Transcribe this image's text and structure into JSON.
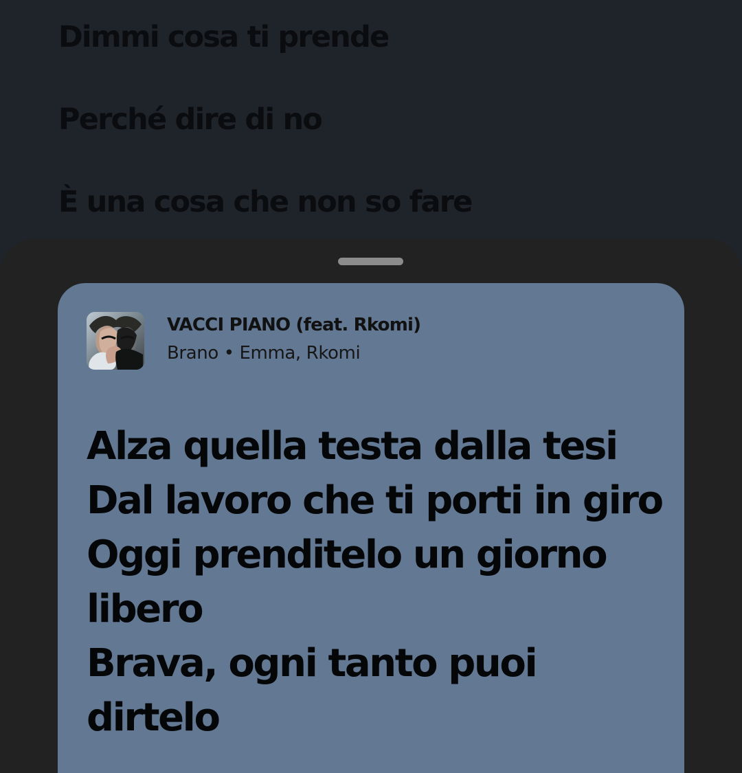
{
  "background_lyrics": [
    "Dimmi cosa ti prende",
    "Perché dire di no",
    "È una cosa che non so fare"
  ],
  "share_sheet": {
    "handle_icon": "drag-handle-icon",
    "card": {
      "background_color": "#637893",
      "cover_icon": "album-cover-image",
      "title": "VACCI PIANO (feat. Rkomi)",
      "subtitle": "Brano • Emma, Rkomi",
      "lyrics": [
        "Alza quella testa dalla tesi",
        "Dal lavoro che ti porti in giro",
        "Oggi prenditelo un giorno",
        "libero",
        "Brava, ogni tanto puoi",
        "dirtelo"
      ]
    }
  },
  "colors": {
    "page_background": "#1f232a",
    "sheet_background": "#222222",
    "text_dark": "#050607"
  }
}
